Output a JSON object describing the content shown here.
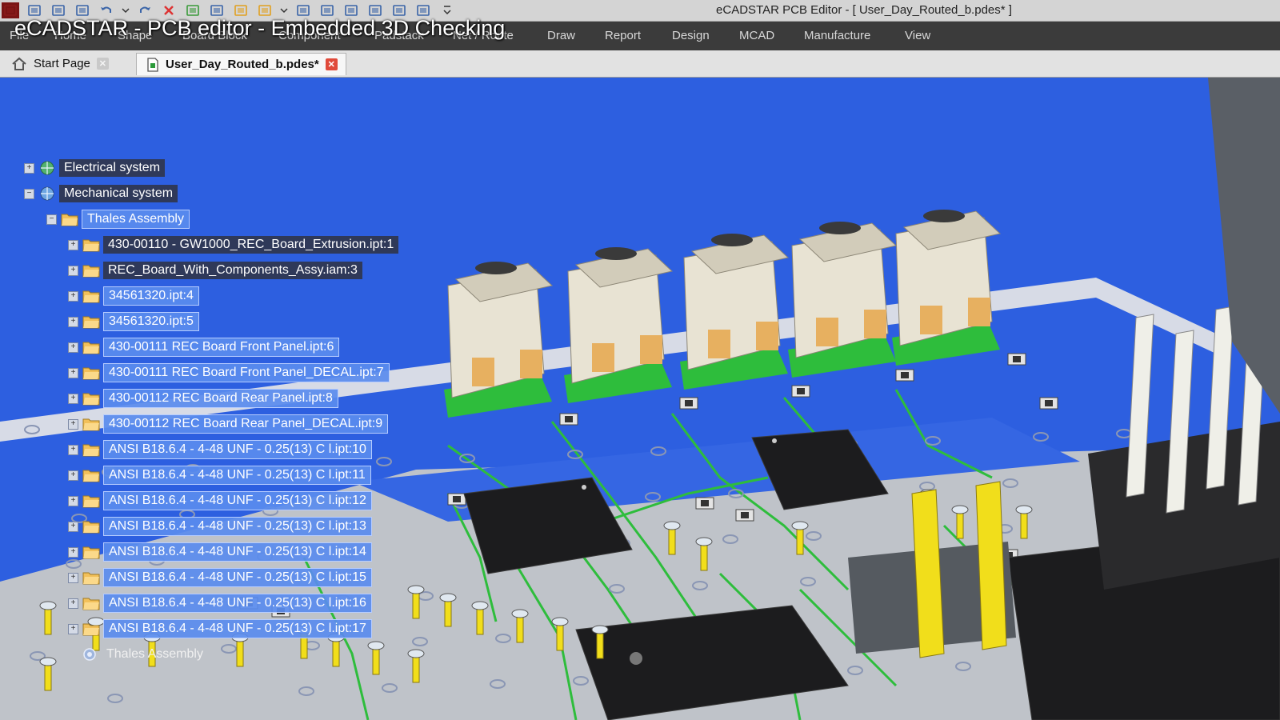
{
  "video_title": "eCADSTAR - PCB editor - Embedded 3D Checking",
  "window": {
    "title": "eCADSTAR PCB Editor - [ User_Day_Routed_b.pdes* ]"
  },
  "quick_access": [
    "app-icon",
    "layout-icon",
    "board-icon",
    "save-icon",
    "undo-icon",
    "dropdown-icon",
    "redo-icon",
    "delete-icon",
    "grid-icon",
    "zoom-icon",
    "highlight-icon",
    "comment-icon",
    "dropdown-icon",
    "dimension-icon",
    "layers-icon",
    "document-icon",
    "route-icon",
    "settings-icon",
    "connect-icon",
    "customize-icon"
  ],
  "menu": {
    "items": [
      "File",
      "Home",
      "Shape",
      "Board Block",
      "Component",
      "Padstack",
      "Net / Route",
      "Draw",
      "Report",
      "Design",
      "MCAD",
      "Manufacture",
      "View"
    ]
  },
  "tabs": [
    {
      "label": "Start Page",
      "icon": "home-icon",
      "active": false
    },
    {
      "label": "User_Day_Routed_b.pdes*",
      "icon": "document-icon",
      "active": true
    }
  ],
  "tree": [
    {
      "label": "Electrical system",
      "level": 0,
      "state": "collapsed",
      "icon": "globe-icon",
      "style": "dark"
    },
    {
      "label": "Mechanical system",
      "level": 0,
      "state": "expanded",
      "icon": "globe-icon",
      "style": "dark"
    },
    {
      "label": "Thales Assembly",
      "level": 1,
      "state": "expanded",
      "icon": "folder-icon",
      "style": "selected"
    },
    {
      "label": "430-00110 - GW1000_REC_Board_Extrusion.ipt:1",
      "level": 2,
      "state": "collapsed",
      "icon": "folder-icon",
      "style": "dark"
    },
    {
      "label": "REC_Board_With_Components_Assy.iam:3",
      "level": 2,
      "state": "collapsed",
      "icon": "folder-icon",
      "style": "dark"
    },
    {
      "label": "34561320.ipt:4",
      "level": 2,
      "state": "collapsed",
      "icon": "folder-icon",
      "style": "selected"
    },
    {
      "label": "34561320.ipt:5",
      "level": 2,
      "state": "collapsed",
      "icon": "folder-icon",
      "style": "selected"
    },
    {
      "label": "430-00111 REC Board Front Panel.ipt:6",
      "level": 2,
      "state": "collapsed",
      "icon": "folder-icon",
      "style": "selected"
    },
    {
      "label": "430-00111 REC Board Front Panel_DECAL.ipt:7",
      "level": 2,
      "state": "collapsed",
      "icon": "folder-icon",
      "style": "selected"
    },
    {
      "label": "430-00112 REC Board Rear Panel.ipt:8",
      "level": 2,
      "state": "collapsed",
      "icon": "folder-icon",
      "style": "selected"
    },
    {
      "label": "430-00112 REC Board Rear Panel_DECAL.ipt:9",
      "level": 2,
      "state": "collapsed",
      "icon": "folder-icon",
      "style": "selected"
    },
    {
      "label": "ANSI B18.6.4 - 4-48 UNF - 0.25(13) C l.ipt:10",
      "level": 2,
      "state": "collapsed",
      "icon": "folder-icon",
      "style": "selected"
    },
    {
      "label": "ANSI B18.6.4 - 4-48 UNF - 0.25(13) C l.ipt:11",
      "level": 2,
      "state": "collapsed",
      "icon": "folder-icon",
      "style": "selected"
    },
    {
      "label": "ANSI B18.6.4 - 4-48 UNF - 0.25(13) C l.ipt:12",
      "level": 2,
      "state": "collapsed",
      "icon": "folder-icon",
      "style": "selected"
    },
    {
      "label": "ANSI B18.6.4 - 4-48 UNF - 0.25(13) C l.ipt:13",
      "level": 2,
      "state": "collapsed",
      "icon": "folder-icon",
      "style": "selected"
    },
    {
      "label": "ANSI B18.6.4 - 4-48 UNF - 0.25(13) C l.ipt:14",
      "level": 2,
      "state": "collapsed",
      "icon": "folder-icon",
      "style": "selected"
    },
    {
      "label": "ANSI B18.6.4 - 4-48 UNF - 0.25(13) C l.ipt:15",
      "level": 2,
      "state": "collapsed",
      "icon": "folder-icon",
      "style": "selected"
    },
    {
      "label": "ANSI B18.6.4 - 4-48 UNF - 0.25(13) C l.ipt:16",
      "level": 2,
      "state": "collapsed",
      "icon": "folder-icon",
      "style": "selected"
    },
    {
      "label": "ANSI B18.6.4 - 4-48 UNF - 0.25(13) C l.ipt:17",
      "level": 2,
      "state": "collapsed",
      "icon": "folder-icon",
      "style": "selected"
    },
    {
      "label": "Thales Assembly",
      "level": 2,
      "state": "none",
      "icon": "assembly-icon",
      "style": "plain"
    }
  ],
  "colors": {
    "board_blue": "#2d5fe0",
    "board_gray": "#bfc3c9",
    "trace_green": "#2ebd3c",
    "pin_yellow": "#f1de1b",
    "selection": "#5a8cee",
    "close_tab": "#e04a3a"
  }
}
